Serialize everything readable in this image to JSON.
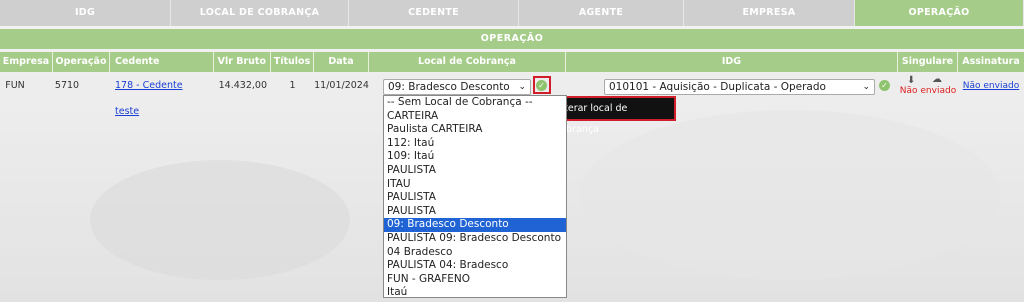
{
  "tabs": [
    "IDG",
    "LOCAL DE COBRANÇA",
    "CEDENTE",
    "AGENTE",
    "EMPRESA",
    "OPERAÇÃO"
  ],
  "section_title": "OPERAÇÃO",
  "columns": {
    "empresa": "Empresa",
    "operacao": "Operação",
    "cedente": "Cedente",
    "vlr_bruto": "Vlr Bruto",
    "titulos": "Títulos",
    "data": "Data",
    "local_cobranca": "Local de Cobrança",
    "idg": "IDG",
    "singulare": "Singulare",
    "assinatura": "Assinatura"
  },
  "row": {
    "empresa": "FUN",
    "operacao": "5710",
    "cedente": "178 - Cedente teste",
    "vlr_bruto": "14.432,00",
    "titulos": "1",
    "data": "11/01/2024",
    "local_cobranca": "09: Bradesco Desconto",
    "idg": "010101 - Aquisição - Duplicata - Operado",
    "singulare_status": "Não enviado",
    "assinatura": "Não enviado"
  },
  "tooltip": "Alterar local de cobrança",
  "dropdown_options": [
    "-- Sem Local de Cobrança --",
    "CARTEIRA",
    "Paulista CARTEIRA",
    "112: Itaú",
    "109: Itaú",
    "PAULISTA",
    "ITAU",
    "PAULISTA",
    "PAULISTA",
    "09: Bradesco Desconto",
    "PAULISTA 09: Bradesco Desconto",
    "04 Bradesco",
    "PAULISTA 04: Bradesco",
    "FUN - GRAFENO",
    "Itaú"
  ],
  "colors": {
    "accent_green": "#a6cc8a",
    "selected_blue": "#1f63d4",
    "alert_red": "#d01f2a"
  },
  "icons": {
    "download": "download-icon",
    "upload": "cloud-upload-icon",
    "check": "check-circle-icon"
  }
}
